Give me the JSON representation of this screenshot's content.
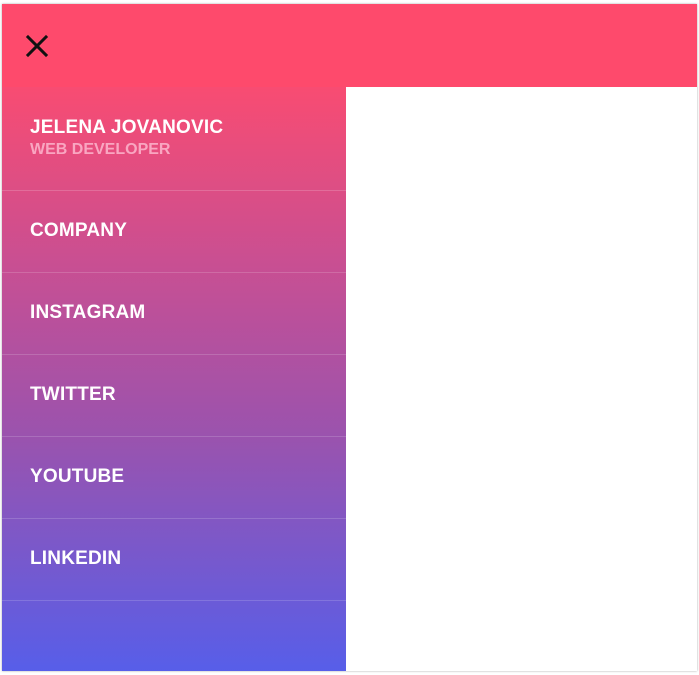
{
  "header": {
    "close_icon": "close-icon",
    "background_color": "#fe4a6c"
  },
  "profile": {
    "name": "JELENA JOVANOVIC",
    "role": "WEB DEVELOPER"
  },
  "menu": {
    "items": [
      {
        "label": "COMPANY"
      },
      {
        "label": "INSTAGRAM"
      },
      {
        "label": "TWITTER"
      },
      {
        "label": "YOUTUBE"
      },
      {
        "label": "LINKEDIN"
      }
    ]
  },
  "colors": {
    "gradient_top": "#f84c72",
    "gradient_bottom": "#575ee9",
    "role_text": "#f9a6c1"
  }
}
